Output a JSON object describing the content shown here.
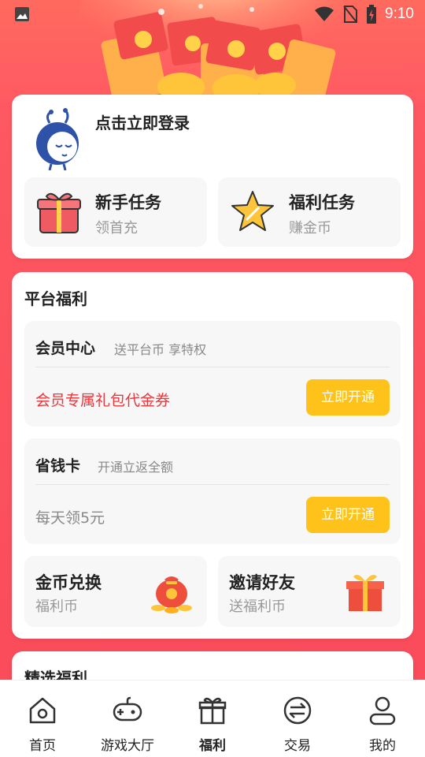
{
  "status_bar": {
    "time": "9:10",
    "icons": [
      "image-icon",
      "wifi-icon",
      "no-sim-icon",
      "battery-charging-icon"
    ]
  },
  "login": {
    "prompt": "点击立即登录",
    "avatar_icon": "avatar-icon"
  },
  "tasks": [
    {
      "title": "新手任务",
      "subtitle": "领首充",
      "icon": "gift-box-icon"
    },
    {
      "title": "福利任务",
      "subtitle": "赚金币",
      "icon": "star-icon"
    }
  ],
  "platform": {
    "title": "平台福利",
    "benefits": [
      {
        "name": "会员中心",
        "desc": "送平台币 享特权",
        "offer": "会员专属礼包代金券",
        "offer_color": "#e8383d",
        "button": "立即开通"
      },
      {
        "name": "省钱卡",
        "desc": "开通立返全额",
        "offer": "每天领5元",
        "offer_color": "#888888",
        "button": "立即开通"
      }
    ],
    "mini": [
      {
        "title": "金币兑换",
        "subtitle": "福利币",
        "icon": "coin-bag-icon"
      },
      {
        "title": "邀请好友",
        "subtitle": "送福利币",
        "icon": "gift-icon"
      }
    ]
  },
  "selected": {
    "title": "精选福利"
  },
  "nav": {
    "items": [
      {
        "label": "首页",
        "icon": "home-icon"
      },
      {
        "label": "游戏大厅",
        "icon": "gamepad-icon"
      },
      {
        "label": "福利",
        "icon": "gift-icon"
      },
      {
        "label": "交易",
        "icon": "exchange-icon"
      },
      {
        "label": "我的",
        "icon": "profile-icon"
      }
    ],
    "active_index": 2
  },
  "colors": {
    "background": "#f94a5a",
    "accent_button": "#ffc21a",
    "offer_red": "#e8383d"
  }
}
